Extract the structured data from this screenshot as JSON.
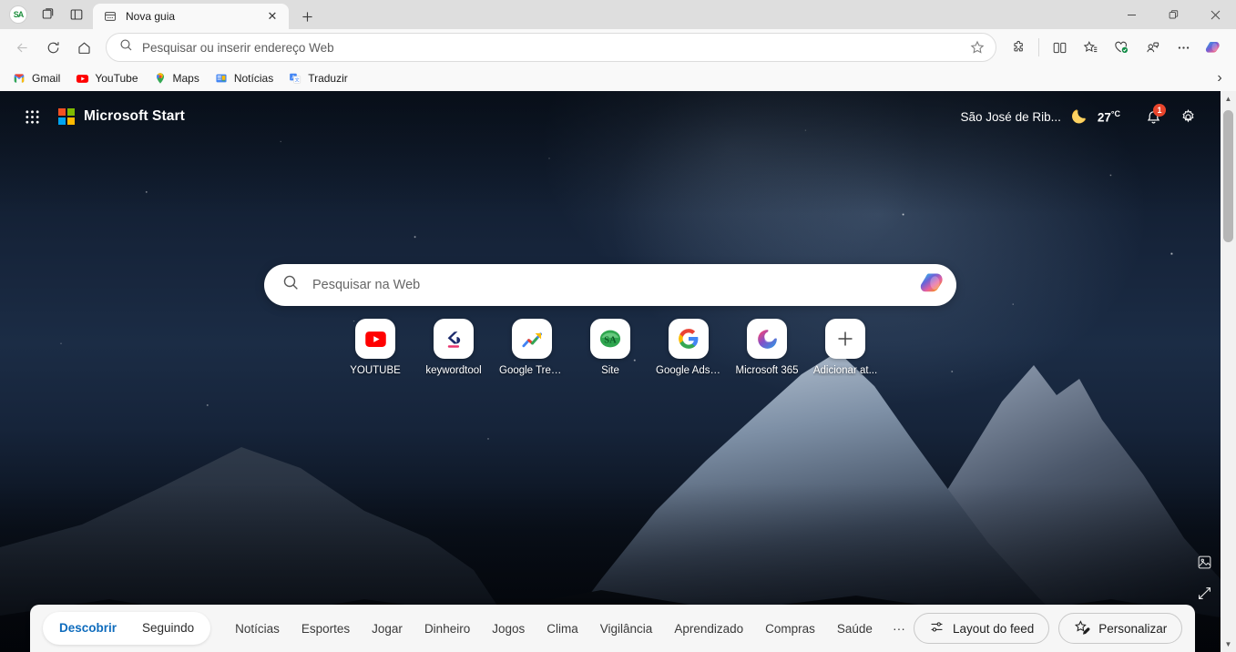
{
  "browser": {
    "tab": {
      "title": "Nova guia",
      "favicon": "newtab-icon",
      "close_label": "✕"
    },
    "newtab_label": "+",
    "window_controls": {
      "minimize": "—",
      "maximize": "❐",
      "close": "✕"
    },
    "nav": {
      "back": "back-arrow-icon",
      "refresh": "refresh-icon",
      "home": "home-icon"
    },
    "omnibox": {
      "placeholder": "Pesquisar ou inserir endereço Web",
      "search_icon": "search-icon",
      "favorite_icon": "star-icon"
    },
    "toolbar_icons": [
      {
        "name": "extensions-icon",
        "label": "Extensões"
      },
      {
        "name": "split-screen-icon",
        "label": "Tela dividida"
      },
      {
        "name": "favorites-icon",
        "label": "Favoritos"
      },
      {
        "name": "browser-essentials-icon",
        "label": "Essenciais do navegador"
      },
      {
        "name": "profile-icon",
        "label": "Perfil"
      },
      {
        "name": "settings-more-icon",
        "label": "Configurações e mais"
      },
      {
        "name": "copilot-icon",
        "label": "Copilot"
      }
    ],
    "bookmarks": [
      {
        "label": "Gmail",
        "icon": "gmail-icon"
      },
      {
        "label": "YouTube",
        "icon": "youtube-icon"
      },
      {
        "label": "Maps",
        "icon": "maps-icon"
      },
      {
        "label": "Notícias",
        "icon": "google-news-icon"
      },
      {
        "label": "Traduzir",
        "icon": "google-translate-icon"
      }
    ],
    "bookmarks_overflow": "›"
  },
  "newtab": {
    "header": {
      "waffle_icon": "app-grid-icon",
      "brand": "Microsoft Start",
      "location": "São José de Rib...",
      "weather_icon": "moon-icon",
      "temperature": "27",
      "temperature_unit": "°C",
      "notifications_icon": "bell-icon",
      "notifications_count": "1",
      "settings_icon": "gear-icon"
    },
    "search": {
      "placeholder": "Pesquisar na Web",
      "search_icon": "search-icon",
      "copilot_icon": "copilot-icon"
    },
    "tiles": [
      {
        "label": "YOUTUBE",
        "icon": "youtube-icon"
      },
      {
        "label": "keywordtool",
        "icon": "keywordtool-icon"
      },
      {
        "label": "Google Trends",
        "icon": "google-trends-icon"
      },
      {
        "label": "Site",
        "icon": "site-icon"
      },
      {
        "label": "Google Adse...",
        "icon": "google-icon"
      },
      {
        "label": "Microsoft 365",
        "icon": "microsoft365-icon"
      },
      {
        "label": "Adicionar at...",
        "icon": "plus-icon"
      }
    ],
    "background_tools": [
      {
        "name": "image-info-icon"
      },
      {
        "name": "expand-icon"
      }
    ],
    "feed": {
      "segments": [
        {
          "label": "Descobrir",
          "active": true
        },
        {
          "label": "Seguindo",
          "active": false
        }
      ],
      "links": [
        "Notícias",
        "Esportes",
        "Jogar",
        "Dinheiro",
        "Jogos",
        "Clima",
        "Vigilância",
        "Aprendizado",
        "Compras",
        "Saúde"
      ],
      "more": "···",
      "layout_button": {
        "label": "Layout do feed",
        "icon": "sliders-icon"
      },
      "personalize_button": {
        "label": "Personalizar",
        "icon": "star-pencil-icon"
      }
    }
  },
  "colors": {
    "accent": "#0f6cbd",
    "badge": "#e8452c",
    "tab_bg": "#f9f9f9",
    "tabstrip_bg": "#dedede"
  }
}
